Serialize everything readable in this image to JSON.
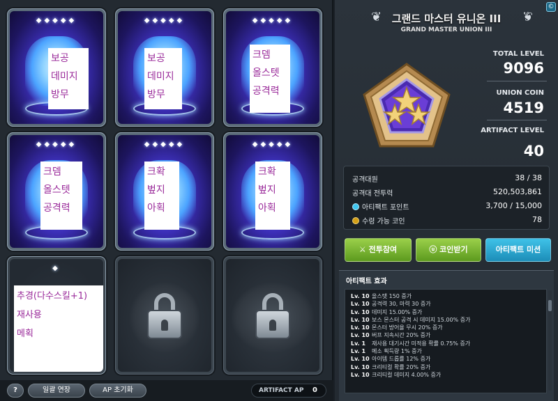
{
  "cards": [
    {
      "stars": "◆◆◆◆◆",
      "lines": [
        "보공",
        "데미지",
        "방무"
      ],
      "locked": false
    },
    {
      "stars": "◆◆◆◆◆",
      "lines": [
        "보공",
        "데미지",
        "방무"
      ],
      "locked": false
    },
    {
      "stars": "◆◆◆◆◆",
      "lines": [
        "크뎀",
        "올스텟",
        "공격력"
      ],
      "locked": false
    },
    {
      "stars": "◆◆◆◆◆",
      "lines": [
        "크뎀",
        "올스텟",
        "공격력"
      ],
      "locked": false
    },
    {
      "stars": "◆◆◆◆◆",
      "lines": [
        "크확",
        "벞지",
        "아획"
      ],
      "locked": false
    },
    {
      "stars": "◆◆◆◆◆",
      "lines": [
        "크확",
        "벞지",
        "아획"
      ],
      "locked": false
    },
    {
      "stars": "◆",
      "lines": [
        "추경(다수스킬+1)",
        "재사용",
        "메획"
      ],
      "locked": false
    },
    {
      "stars": "",
      "lines": [],
      "locked": true
    },
    {
      "stars": "",
      "lines": [],
      "locked": true
    }
  ],
  "bottombar": {
    "help": "?",
    "extend": "일괄 연장",
    "ap_reset": "AP 초기화",
    "artifact_ap_label": "ARTIFACT AP",
    "artifact_ap_value": "0"
  },
  "header": {
    "title": "그랜드 마스터 유니온 III",
    "subtitle": "GRAND MASTER UNION III",
    "corner": "©"
  },
  "stats": {
    "total_level_label": "TOTAL LEVEL",
    "total_level": "9096",
    "union_coin_label": "UNION COIN",
    "union_coin": "4519",
    "artifact_level_label": "ARTIFACT LEVEL",
    "artifact_level": "40"
  },
  "info": {
    "rows": [
      {
        "label": "공격대원",
        "value": "38 / 38"
      },
      {
        "label": "공격대 전투력",
        "value": "520,503,861"
      },
      {
        "label": "아티팩트 포인트",
        "value": "3,700 / 15,000"
      },
      {
        "label": "수령 가능 코인",
        "value": "78"
      }
    ]
  },
  "buttons": {
    "battle": "전투참여",
    "coin": "코인받기",
    "mission": "아티팩트 미션"
  },
  "effects": {
    "title": "아티팩트 효과",
    "items": [
      {
        "lv": "Lv. 10",
        "text": "올스탯 150 증가"
      },
      {
        "lv": "Lv. 10",
        "text": "공격력 30, 마력 30 증가"
      },
      {
        "lv": "Lv. 10",
        "text": "데미지 15.00% 증가"
      },
      {
        "lv": "Lv. 10",
        "text": "보스 몬스터 공격 시 데미지 15.00% 증가"
      },
      {
        "lv": "Lv. 10",
        "text": "몬스터 방어율 무시 20% 증가"
      },
      {
        "lv": "Lv. 10",
        "text": "버프 지속시간 20% 증가"
      },
      {
        "lv": "Lv. 1",
        "text": "재사용 대기시간 미적용 확률 0.75% 증가"
      },
      {
        "lv": "Lv. 1",
        "text": "메소 획득량 1% 증가"
      },
      {
        "lv": "Lv. 10",
        "text": "아이템 드롭률 12% 증가"
      },
      {
        "lv": "Lv. 10",
        "text": "크리티컬 확률 20% 증가"
      },
      {
        "lv": "Lv. 10",
        "text": "크리티컬 데미지 4.00% 증가"
      }
    ]
  },
  "colors": {
    "card_purple": "#3c2fb8",
    "label_text": "#9a2a9a",
    "btn_green": "#7cb634",
    "btn_blue": "#2aa8d4",
    "coin_gold": "#d4a017",
    "point_cyan": "#3ec6f0"
  }
}
